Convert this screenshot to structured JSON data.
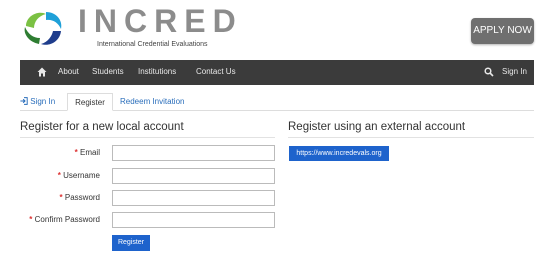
{
  "header": {
    "logo_text": "INCRED",
    "logo_subtitle": "International Credential Evaluations",
    "apply_label": "APPLY NOW"
  },
  "nav": {
    "items": [
      "About",
      "Students",
      "Institutions",
      "Contact Us"
    ],
    "sign_in": "Sign In"
  },
  "tabs": {
    "sign_in": "Sign In",
    "register": "Register",
    "redeem": "Redeem Invitation"
  },
  "local": {
    "title": "Register for a new local account",
    "fields": [
      {
        "label": "Email",
        "required": "*",
        "value": ""
      },
      {
        "label": "Username",
        "required": "*",
        "value": ""
      },
      {
        "label": "Password",
        "required": "*",
        "value": ""
      },
      {
        "label": "Confirm Password",
        "required": "*",
        "value": ""
      }
    ],
    "submit": "Register"
  },
  "external": {
    "title": "Register using an external account",
    "provider": "https://www.incredevals.org"
  },
  "colors": {
    "nav_bg": "#3b3b3b",
    "link": "#2a6ebb",
    "primary_button": "#1e63cc",
    "apply_button": "#6f6f6f"
  }
}
